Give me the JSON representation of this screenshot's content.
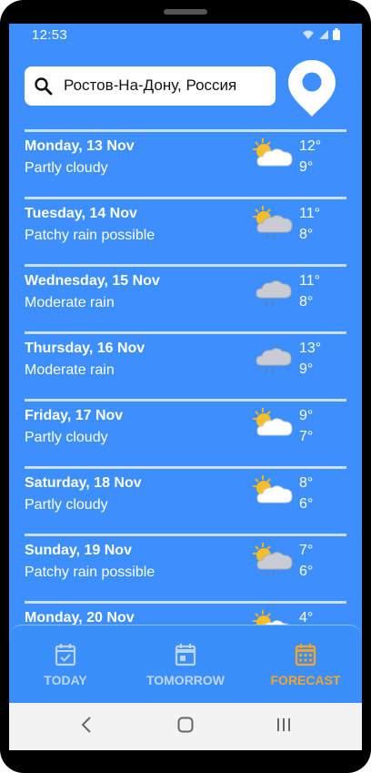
{
  "status_bar": {
    "time": "12:53"
  },
  "search": {
    "value": "Ростов-На-Дону, Россия"
  },
  "forecast": [
    {
      "date": "Monday, 13 Nov",
      "condition": "Partly cloudy",
      "max": "12°",
      "min": "9°",
      "icon": "partly-cloudy-icon"
    },
    {
      "date": "Tuesday, 14 Nov",
      "condition": "Patchy rain possible",
      "max": "11°",
      "min": "8°",
      "icon": "patchy-rain-icon"
    },
    {
      "date": "Wednesday, 15 Nov",
      "condition": "Moderate rain",
      "max": "11°",
      "min": "8°",
      "icon": "moderate-rain-icon"
    },
    {
      "date": "Thursday, 16 Nov",
      "condition": "Moderate rain",
      "max": "13°",
      "min": "9°",
      "icon": "moderate-rain-icon"
    },
    {
      "date": "Friday, 17 Nov",
      "condition": "Partly cloudy",
      "max": "9°",
      "min": "7°",
      "icon": "partly-cloudy-icon"
    },
    {
      "date": "Saturday, 18 Nov",
      "condition": "Partly cloudy",
      "max": "8°",
      "min": "6°",
      "icon": "partly-cloudy-icon"
    },
    {
      "date": "Sunday, 19 Nov",
      "condition": "Patchy rain possible",
      "max": "7°",
      "min": "6°",
      "icon": "patchy-rain-icon"
    },
    {
      "date": "Monday, 20 Nov",
      "condition": "",
      "max": "4°",
      "min": "",
      "icon": "partly-cloudy-icon"
    }
  ],
  "bottom_nav": {
    "today": "TODAY",
    "tomorrow": "TOMORROW",
    "forecast": "FORECAST",
    "active": "forecast"
  },
  "colors": {
    "background": "#3d8ffe",
    "active_tab": "#f3a52a",
    "inactive_tab": "#bcd6fb"
  }
}
